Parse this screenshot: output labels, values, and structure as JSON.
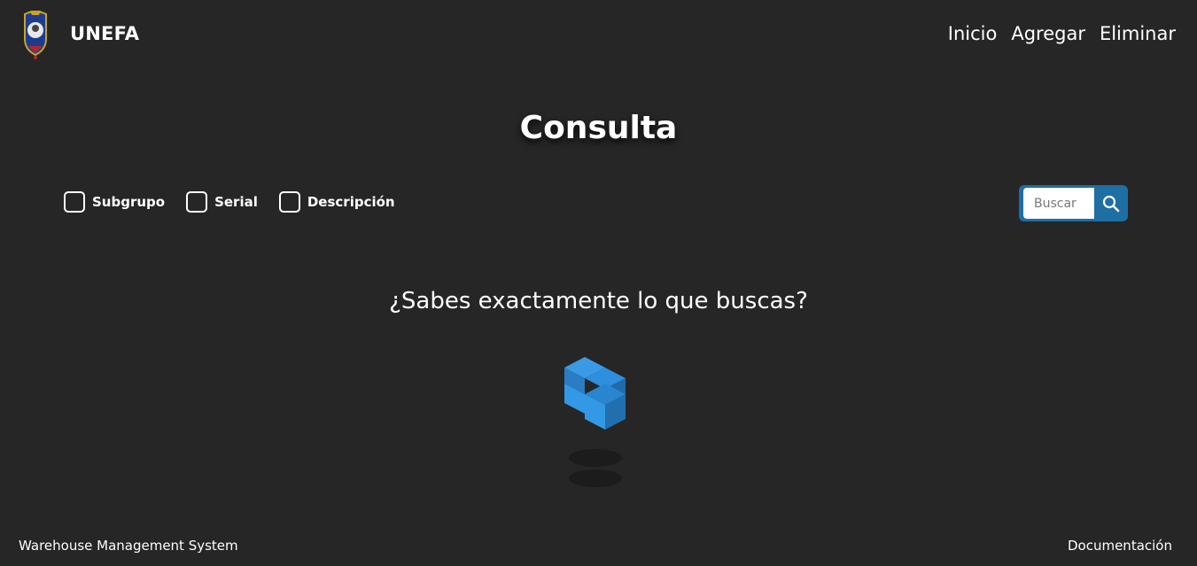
{
  "header": {
    "brand": "UNEFA",
    "nav": [
      "Inicio",
      "Agregar",
      "Eliminar"
    ]
  },
  "main": {
    "title": "Consulta",
    "filters": [
      "Subgrupo",
      "Serial",
      "Descripción"
    ],
    "search": {
      "placeholder": "Buscar"
    },
    "question": "¿Sabes exactamente lo que buscas?"
  },
  "footer": {
    "left": "Warehouse Management System",
    "right": "Documentación"
  },
  "colors": {
    "background": "#262626",
    "accent": "#1e6fa3",
    "cube": "#2e8fde"
  }
}
